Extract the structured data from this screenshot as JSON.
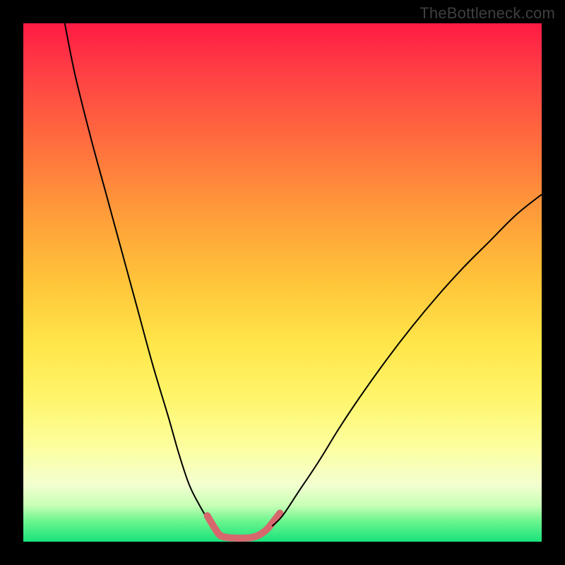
{
  "watermark": "TheBottleneck.com",
  "chart_data": {
    "type": "line",
    "title": "",
    "xlabel": "",
    "ylabel": "",
    "xlim": [
      0,
      100
    ],
    "ylim": [
      0,
      100
    ],
    "grid": false,
    "legend": false,
    "annotations": [],
    "background_gradient_stops": [
      {
        "pct": 0,
        "color": "#ff1a44"
      },
      {
        "pct": 8,
        "color": "#ff3a45"
      },
      {
        "pct": 22,
        "color": "#ff6a3e"
      },
      {
        "pct": 36,
        "color": "#ff9a3a"
      },
      {
        "pct": 50,
        "color": "#ffc53a"
      },
      {
        "pct": 62,
        "color": "#ffe64a"
      },
      {
        "pct": 72,
        "color": "#fff56a"
      },
      {
        "pct": 82,
        "color": "#fcffa0"
      },
      {
        "pct": 89,
        "color": "#f3ffd0"
      },
      {
        "pct": 93,
        "color": "#c8ffb6"
      },
      {
        "pct": 96,
        "color": "#6cf58f"
      },
      {
        "pct": 100,
        "color": "#18e27a"
      }
    ],
    "series": [
      {
        "name": "left-descent",
        "color": "#000000",
        "stroke_width": 2,
        "x": [
          8,
          10,
          13,
          16,
          19,
          22,
          25,
          28,
          30,
          32,
          34,
          35.5,
          37
        ],
        "y": [
          100,
          90,
          78,
          67,
          56,
          45,
          34,
          24,
          17,
          11,
          7,
          4.5,
          2.5
        ]
      },
      {
        "name": "valley-floor",
        "color": "#d6686d",
        "stroke_width": 10,
        "linecap": "round",
        "x": [
          35.5,
          37,
          38,
          39.5,
          41,
          42.5,
          44,
          45.5,
          47,
          48.5,
          49.5
        ],
        "y": [
          5,
          2.5,
          1.2,
          0.8,
          0.7,
          0.7,
          0.8,
          1.3,
          2.4,
          4.2,
          5.5
        ]
      },
      {
        "name": "right-ascent",
        "color": "#000000",
        "stroke_width": 2,
        "x": [
          48,
          50,
          53,
          57,
          61,
          65,
          70,
          75,
          80,
          85,
          90,
          95,
          100
        ],
        "y": [
          3,
          5,
          9.5,
          15.5,
          22,
          28,
          35,
          41.5,
          47.5,
          53,
          58,
          63,
          67
        ]
      }
    ]
  }
}
